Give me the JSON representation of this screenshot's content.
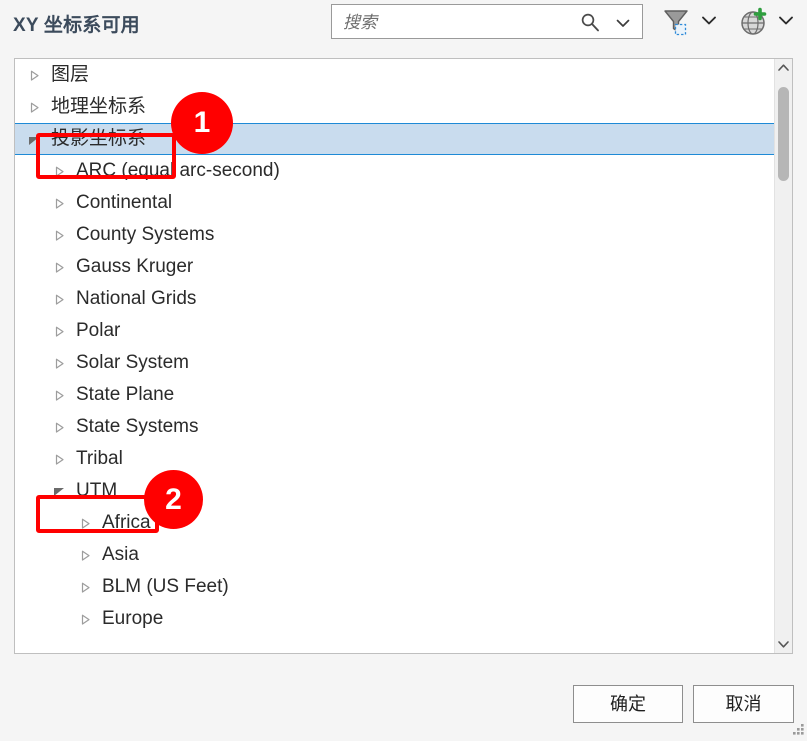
{
  "dialog": {
    "title": "XY 坐标系可用"
  },
  "search": {
    "placeholder": "搜索",
    "value": "",
    "icon": "search-icon",
    "dropdown_icon": "chevron-down-icon"
  },
  "toolbar": {
    "filter": {
      "icon": "filter-funnel-icon",
      "dropdown_icon": "chevron-down-icon"
    },
    "globe": {
      "icon": "globe-add-icon",
      "dropdown_icon": "chevron-down-icon"
    }
  },
  "tree": {
    "items": [
      {
        "label": "图层",
        "level": 0,
        "expanded": false,
        "selected": false
      },
      {
        "label": "地理坐标系",
        "level": 0,
        "expanded": false,
        "selected": false
      },
      {
        "label": "投影坐标系",
        "level": 0,
        "expanded": true,
        "selected": true
      },
      {
        "label": "ARC (equal arc-second)",
        "level": 1,
        "expanded": false,
        "selected": false
      },
      {
        "label": "Continental",
        "level": 1,
        "expanded": false,
        "selected": false
      },
      {
        "label": "County Systems",
        "level": 1,
        "expanded": false,
        "selected": false
      },
      {
        "label": "Gauss Kruger",
        "level": 1,
        "expanded": false,
        "selected": false
      },
      {
        "label": "National Grids",
        "level": 1,
        "expanded": false,
        "selected": false
      },
      {
        "label": "Polar",
        "level": 1,
        "expanded": false,
        "selected": false
      },
      {
        "label": "Solar System",
        "level": 1,
        "expanded": false,
        "selected": false
      },
      {
        "label": "State Plane",
        "level": 1,
        "expanded": false,
        "selected": false
      },
      {
        "label": "State Systems",
        "level": 1,
        "expanded": false,
        "selected": false
      },
      {
        "label": "Tribal",
        "level": 1,
        "expanded": false,
        "selected": false
      },
      {
        "label": "UTM",
        "level": 1,
        "expanded": true,
        "selected": false
      },
      {
        "label": "Africa",
        "level": 2,
        "expanded": false,
        "selected": false
      },
      {
        "label": "Asia",
        "level": 2,
        "expanded": false,
        "selected": false
      },
      {
        "label": "BLM (US Feet)",
        "level": 2,
        "expanded": false,
        "selected": false
      },
      {
        "label": "Europe",
        "level": 2,
        "expanded": false,
        "selected": false
      }
    ]
  },
  "scrollbar": {
    "up_icon": "chevron-up-icon",
    "down_icon": "chevron-down-icon"
  },
  "footer": {
    "ok_label": "确定",
    "cancel_label": "取消"
  },
  "annotations": {
    "colors": {
      "marker": "#ff0000"
    },
    "steps": [
      {
        "number": "1",
        "target": "投影坐标系"
      },
      {
        "number": "2",
        "target": "UTM"
      }
    ]
  }
}
